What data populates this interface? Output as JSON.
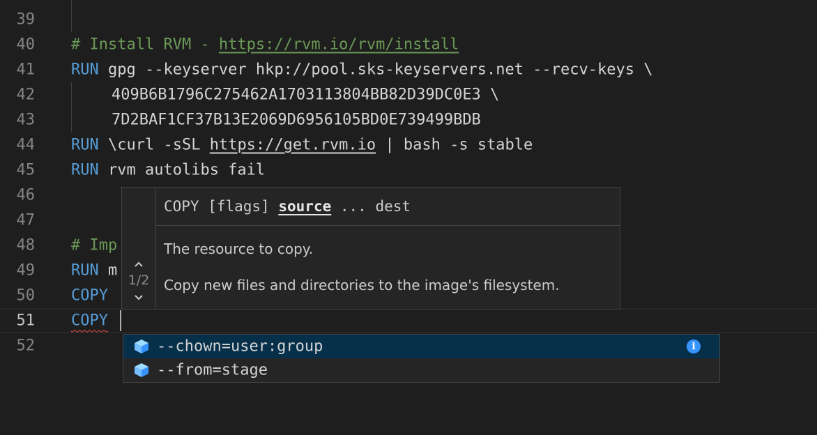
{
  "colors": {
    "background": "#1e1e1e",
    "keyword": "#569cd6",
    "comment": "#6a9955",
    "text": "#d4d4d4",
    "line_number": "#858585",
    "selection": "#062f4a",
    "info_icon": "#3794ff",
    "error_squiggle": "#f14c4c"
  },
  "editor": {
    "lines": [
      {
        "number": "39"
      },
      {
        "number": "40",
        "comment_prefix": "# Install RVM - ",
        "comment_url": "https://rvm.io/rvm/install"
      },
      {
        "number": "41",
        "keyword": "RUN",
        "rest": " gpg --keyserver hkp://pool.sks-keyservers.net --recv-keys \\"
      },
      {
        "number": "42",
        "text": "409B6B1796C275462A1703113804BB82D39DC0E3 \\"
      },
      {
        "number": "43",
        "text": "7D2BAF1CF37B13E2069D6956105BD0E739499BDB"
      },
      {
        "number": "44",
        "keyword": "RUN",
        "rest_a": " \\curl -sSL ",
        "url": "https://get.rvm.io",
        "rest_b": " | bash -s stable"
      },
      {
        "number": "45",
        "keyword": "RUN",
        "rest": " rvm autolibs fail"
      },
      {
        "number": "46"
      },
      {
        "number": "47"
      },
      {
        "number": "48",
        "comment": "# Imp"
      },
      {
        "number": "49",
        "keyword": "RUN",
        "rest": " m"
      },
      {
        "number": "50",
        "keyword": "COPY"
      },
      {
        "number": "51",
        "keyword": "COPY"
      },
      {
        "number": "52"
      }
    ]
  },
  "signature_help": {
    "up_icon": "chevron-up-icon",
    "down_icon": "chevron-down-icon",
    "counter": "1/2",
    "label_prefix": "COPY [flags] ",
    "label_active": "source",
    "label_suffix": " ... dest",
    "param_doc": "The resource to copy.",
    "doc": "Copy new files and directories to the image's filesystem."
  },
  "suggestions": {
    "items": [
      {
        "label": "--chown=user:group",
        "icon": "property-icon",
        "selected": true
      },
      {
        "label": "--from=stage",
        "icon": "property-icon",
        "selected": false
      }
    ],
    "info_icon": "info-icon",
    "info_glyph": "i"
  }
}
